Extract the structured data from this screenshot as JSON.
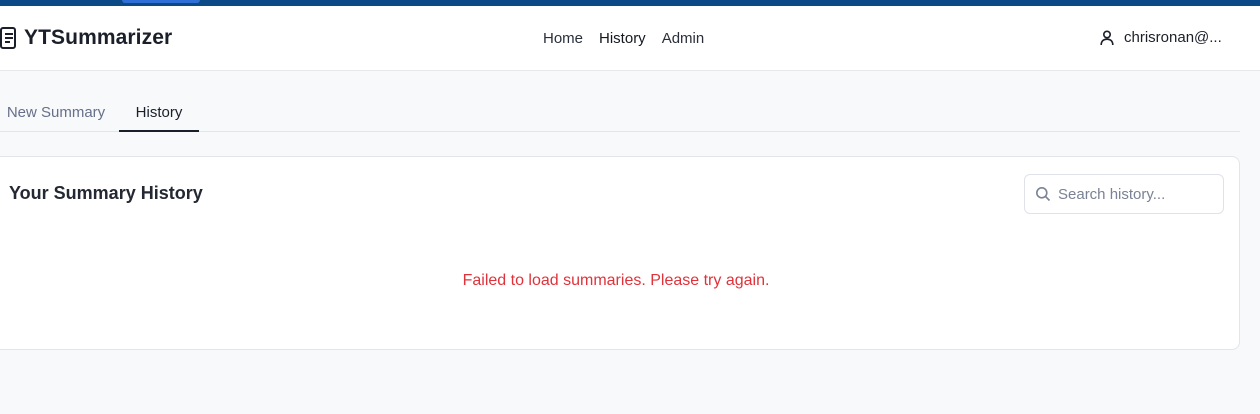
{
  "app": {
    "brand_name": "YTSummarizer",
    "brand_icon": "summary-icon"
  },
  "nav": {
    "items": [
      {
        "label": "Home"
      },
      {
        "label": "History"
      },
      {
        "label": "Admin"
      }
    ]
  },
  "user": {
    "email": "chrisronan@...",
    "icon": "user-icon"
  },
  "tabs": [
    {
      "label": "New Summary",
      "active": false
    },
    {
      "label": "History",
      "active": true
    }
  ],
  "history": {
    "title": "Your Summary History",
    "search_placeholder": "Search history...",
    "search_value": "",
    "error_message": "Failed to load summaries. Please try again."
  },
  "colors": {
    "top_strip": "#0b4a86",
    "error": "#e0323a",
    "accent": "#1b1f29"
  }
}
